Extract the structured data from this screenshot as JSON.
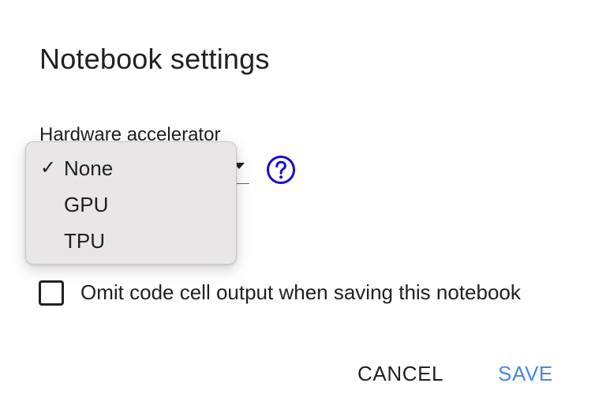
{
  "dialog": {
    "title": "Notebook settings"
  },
  "accelerator": {
    "label": "Hardware accelerator",
    "selected": "None",
    "options": [
      {
        "label": "None",
        "checked": true
      },
      {
        "label": "GPU",
        "checked": false
      },
      {
        "label": "TPU",
        "checked": false
      }
    ],
    "check_glyph": "✓",
    "help_icon": "help-circle-icon"
  },
  "omit_output": {
    "label": "Omit code cell output when saving this notebook",
    "checked": false
  },
  "actions": {
    "cancel_label": "CANCEL",
    "save_label": "SAVE"
  },
  "colors": {
    "accent": "#4a86e8",
    "help_icon": "#1a0dcc",
    "text": "#202124"
  }
}
